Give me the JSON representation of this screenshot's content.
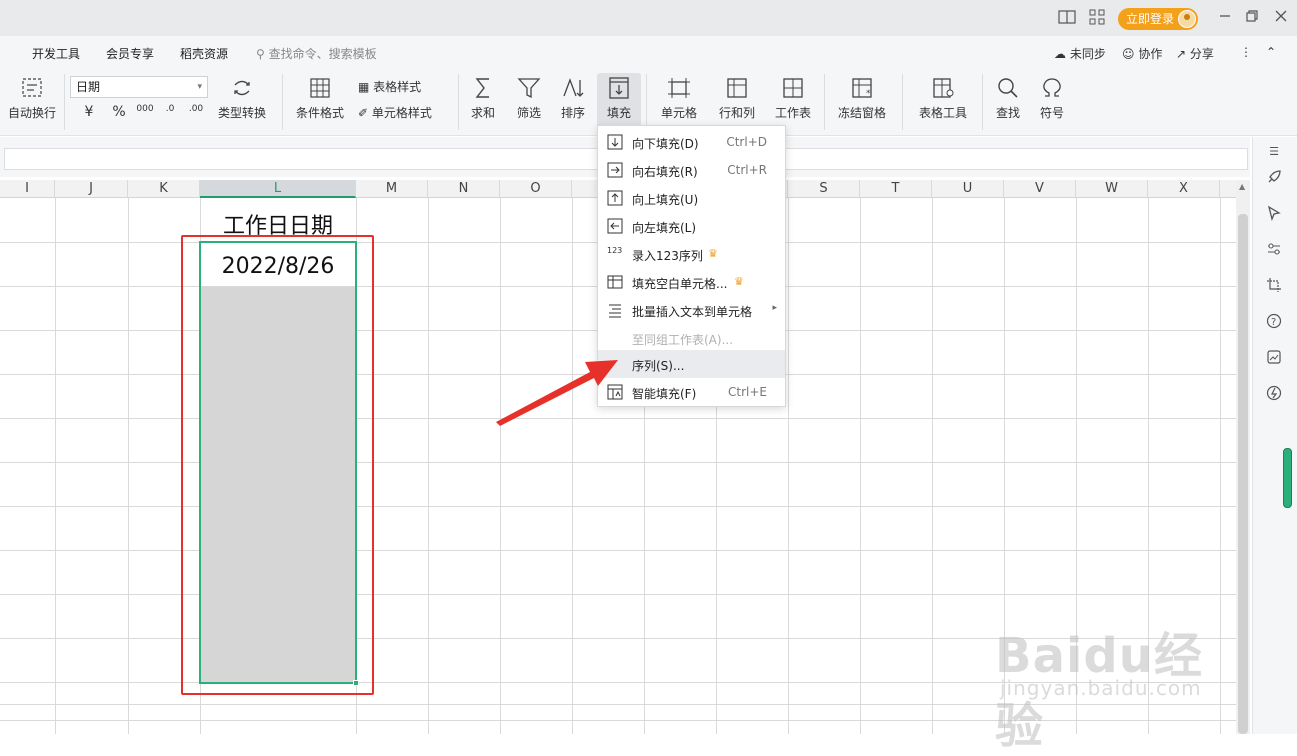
{
  "titlebar": {
    "login_label": "立即登录",
    "icons": [
      "split-view-icon",
      "grid-apps-icon",
      "minimize-icon",
      "restore-icon",
      "close-icon"
    ]
  },
  "menu": {
    "items": [
      "开发工具",
      "会员专享",
      "稻壳资源"
    ],
    "search_placeholder": "查找命令、搜索模板",
    "sync_label": "未同步",
    "collab_label": "协作",
    "share_label": "分享"
  },
  "ribbon": {
    "auto_wrap": "自动换行",
    "number_format_value": "日期",
    "currency": "¥",
    "percent": "%",
    "thousands": "000",
    "dec_inc": ".0",
    "dec_dec": ".00",
    "type_convert": "类型转换",
    "cond_format": "条件格式",
    "table_style": "表格样式",
    "cell_style": "单元格样式",
    "sum": "求和",
    "filter": "筛选",
    "sort": "排序",
    "fill": "填充",
    "cell": "单元格",
    "row_col": "行和列",
    "sheet": "工作表",
    "freeze": "冻结窗格",
    "table_tools": "表格工具",
    "find": "查找",
    "symbol": "符号"
  },
  "columns": [
    "I",
    "J",
    "K",
    "L",
    "M",
    "N",
    "O",
    "S",
    "T",
    "U",
    "V",
    "W",
    "X"
  ],
  "cells": {
    "header": "工作日日期",
    "date": "2022/8/26"
  },
  "fill_menu": {
    "items": [
      {
        "label": "向下填充(D)",
        "shortcut": "Ctrl+D"
      },
      {
        "label": "向右填充(R)",
        "shortcut": "Ctrl+R"
      },
      {
        "label": "向上填充(U)",
        "shortcut": ""
      },
      {
        "label": "向左填充(L)",
        "shortcut": ""
      },
      {
        "label": "录入123序列",
        "shortcut": ""
      },
      {
        "label": "填充空白单元格...",
        "shortcut": ""
      },
      {
        "label": "批量插入文本到单元格",
        "shortcut": ""
      },
      {
        "label": "至同组工作表(A)...",
        "shortcut": ""
      },
      {
        "label": "序列(S)...",
        "shortcut": ""
      },
      {
        "label": "智能填充(F)",
        "shortcut": "Ctrl+E"
      }
    ],
    "seq_icon_label": "123"
  },
  "watermark": {
    "main": "Baidu经验",
    "sub": "jingyan.baidu.com"
  },
  "colors": {
    "accent_green": "#2bb07c",
    "highlight_red": "#e8302a",
    "login_orange": "#f3a01b"
  }
}
